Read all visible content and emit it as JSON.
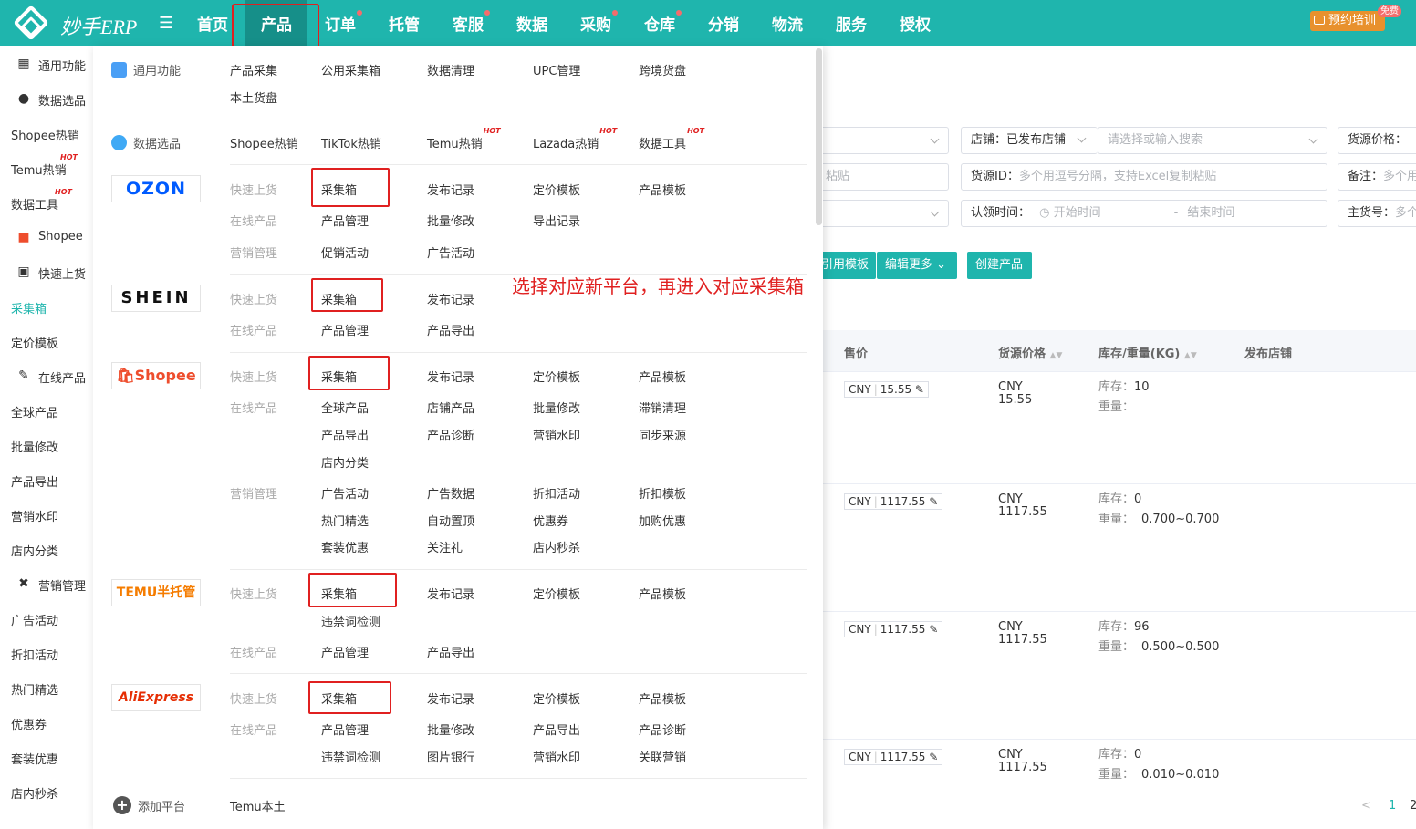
{
  "header": {
    "logo": "妙手ERP",
    "nav": [
      "首页",
      "产品",
      "订单",
      "托管",
      "客服",
      "数据",
      "采购",
      "仓库",
      "分销",
      "物流",
      "服务",
      "授权"
    ],
    "train": "预约培训",
    "free_badge": "免费"
  },
  "sidebar": [
    "通用功能",
    "数据选品",
    "Shopee热销",
    "Temu热销",
    "数据工具",
    "Shopee",
    "快速上货",
    "采集箱",
    "定价模板",
    "在线产品",
    "全球产品",
    "批量修改",
    "产品导出",
    "营销水印",
    "店内分类",
    "营销管理",
    "广告活动",
    "折扣活动",
    "热门精选",
    "优惠券",
    "套装优惠",
    "店内秒杀"
  ],
  "hot": "HOT",
  "filters": {
    "shop": "店铺：已发布店铺",
    "shop_ph": "请选择或输入搜索",
    "source_price": "货源价格：",
    "paste_tail": "粘贴",
    "source_id_label": "货源ID：",
    "source_id_ph": "多个用逗号分隔，支持Excel复制粘贴",
    "remark_label": "备注：",
    "remark_ph": "多个用",
    "claim_label": "认领时间：",
    "start_ph": "开始时间",
    "dash": "-",
    "end_ph": "结束时间",
    "sku_label": "主货号：",
    "sku_ph": "多个"
  },
  "toolbar": {
    "apply_template": "引用模板",
    "edit_more": "编辑更多",
    "create": "创建产品"
  },
  "table": {
    "headers": [
      "售价",
      "货源价格",
      "库存/重量(KG)",
      "发布店铺"
    ],
    "rows": [
      {
        "sale": "CNY",
        "sale_val": "15.55",
        "src": "CNY",
        "src_val": "15.55",
        "stock": "库存：",
        "stock_val": "10",
        "weight": "重量：",
        "weight_val": ""
      },
      {
        "sale": "CNY",
        "sale_val": "1117.55",
        "src": "CNY",
        "src_val": "1117.55",
        "stock": "库存：",
        "stock_val": "0",
        "weight": "重量：",
        "weight_val": "0.700~0.700"
      },
      {
        "sale": "CNY",
        "sale_val": "1117.55",
        "src": "CNY",
        "src_val": "1117.55",
        "stock": "库存：",
        "stock_val": "96",
        "weight": "重量：",
        "weight_val": "0.500~0.500"
      },
      {
        "sale": "CNY",
        "sale_val": "1117.55",
        "src": "CNY",
        "src_val": "1117.55",
        "stock": "库存：",
        "stock_val": "0",
        "weight": "重量：",
        "weight_val": "0.010~0.010"
      }
    ],
    "pager": {
      "prev": "<",
      "page": "1",
      "next": "2"
    }
  },
  "dropdown": {
    "general": {
      "title": "通用功能",
      "items": [
        "产品采集",
        "公用采集箱",
        "数据清理",
        "UPC管理",
        "跨境货盘",
        "本土货盘"
      ]
    },
    "select": {
      "title": "数据选品",
      "items": [
        "Shopee热销",
        "TikTok热销",
        "Temu热销",
        "Lazada热销",
        "数据工具"
      ]
    },
    "ozon": {
      "logo": "OZON",
      "quick": "快速上货",
      "online": "在线产品",
      "marketing": "营销管理",
      "items": [
        "采集箱",
        "发布记录",
        "定价模板",
        "产品模板",
        "产品管理",
        "批量修改",
        "导出记录",
        "促销活动",
        "广告活动"
      ]
    },
    "shein": {
      "logo": "SHEIN",
      "quick": "快速上货",
      "online": "在线产品",
      "items": [
        "采集箱",
        "发布记录",
        "产品管理",
        "产品导出"
      ]
    },
    "shopee": {
      "logo": "Shopee",
      "quick": "快速上货",
      "online": "在线产品",
      "marketing": "营销管理",
      "items": [
        "采集箱",
        "发布记录",
        "定价模板",
        "产品模板",
        "全球产品",
        "店铺产品",
        "批量修改",
        "滞销清理",
        "产品导出",
        "产品诊断",
        "营销水印",
        "同步来源",
        "店内分类",
        "广告活动",
        "广告数据",
        "折扣活动",
        "折扣模板",
        "热门精选",
        "自动置顶",
        "优惠券",
        "加购优惠",
        "套装优惠",
        "关注礼",
        "店内秒杀"
      ]
    },
    "temu": {
      "logo": "TEMU半托管",
      "quick": "快速上货",
      "online": "在线产品",
      "items": [
        "采集箱",
        "发布记录",
        "定价模板",
        "产品模板",
        "违禁词检测",
        "产品管理",
        "产品导出"
      ]
    },
    "ali": {
      "logo": "AliExpress",
      "quick": "快速上货",
      "online": "在线产品",
      "items": [
        "采集箱",
        "发布记录",
        "定价模板",
        "产品模板",
        "产品管理",
        "批量修改",
        "产品导出",
        "产品诊断",
        "违禁词检测",
        "图片银行",
        "营销水印",
        "关联营销"
      ]
    },
    "add": {
      "title": "添加平台",
      "item": "Temu本土"
    },
    "annotation": "选择对应新平台，再进入对应采集箱"
  }
}
